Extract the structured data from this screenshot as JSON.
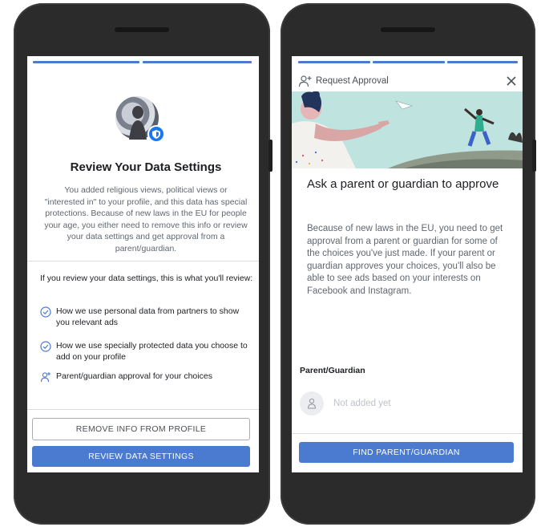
{
  "left_screen": {
    "title": "Review Your Data Settings",
    "description": "You added religious views, political views or \"interested in\" to your profile, and this data has special protections. Because of new laws in the EU for people your age, you either need to remove this info or review your data settings and get approval from a parent/guardian.",
    "intro": "If you review your data settings, this is what you'll review:",
    "items": [
      {
        "icon": "check-circle-icon",
        "label": "How we use personal data from partners to show you relevant ads"
      },
      {
        "icon": "check-circle-icon",
        "label": "How we use specially protected data you choose to add on your profile"
      },
      {
        "icon": "add-person-icon",
        "label": "Parent/guardian approval for your choices"
      }
    ],
    "remove_button": "REMOVE INFO FROM PROFILE",
    "review_button": "REVIEW DATA SETTINGS"
  },
  "right_screen": {
    "header_title": "Request Approval",
    "title": "Ask a parent or guardian to approve",
    "description": "Because of new laws in the EU, you need to get approval from a parent or guardian for some of the choices you've just made. If your parent or guardian approves your choices, you'll also be able to see ads based on your interests on Facebook and Instagram.",
    "guardian_label": "Parent/Guardian",
    "guardian_placeholder": "Not added yet",
    "find_button": "FIND PARENT/GUARDIAN"
  },
  "colors": {
    "accent": "#4a7bd0",
    "brand_blue": "#1877f2",
    "text_dark": "#1c1e21",
    "text_grey": "#606770",
    "phone_body": "#2b2b2b"
  }
}
